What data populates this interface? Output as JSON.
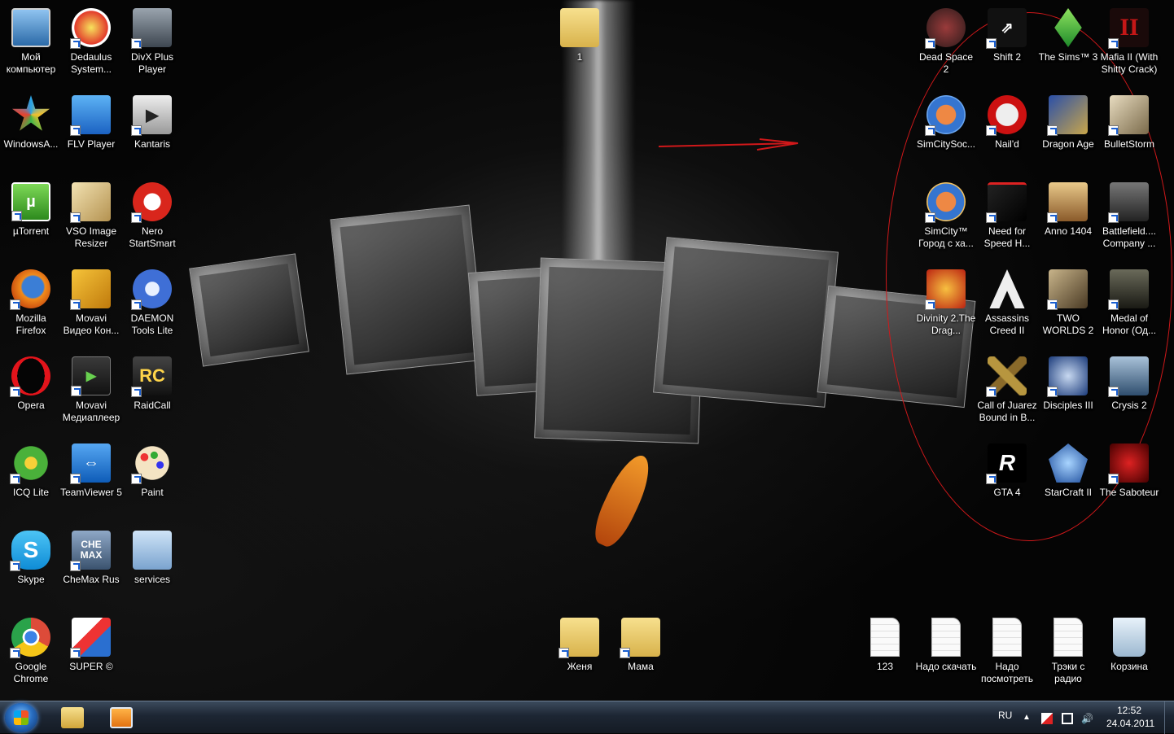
{
  "desktop_icons": {
    "my_computer": "Мой компьютер",
    "dedaulus": "Dedaulus System...",
    "divx": "DivX Plus Player",
    "windowsa": "WindowsA...",
    "flv": "FLV Player",
    "kantaris": "Kantaris",
    "utorrent": "µTorrent",
    "vso": "VSO Image Resizer",
    "nero": "Nero StartSmart",
    "firefox": "Mozilla Firefox",
    "movavi_video": "Movavi Видео Кон...",
    "daemon": "DAEMON Tools Lite",
    "opera": "Opera",
    "movavi_player": "Movavi Медиаплеер",
    "raidcall": "RaidCall",
    "icq": "ICQ Lite",
    "teamviewer": "TeamViewer 5",
    "paint": "Paint",
    "skype": "Skype",
    "chemax": "CheMax Rus",
    "services": "services",
    "chrome": "Google Chrome",
    "super": "SUPER ©",
    "folder_1": "1",
    "zhenya": "Женя",
    "mama": "Мама",
    "dead_space": "Dead Space 2",
    "shift2": "Shift 2",
    "sims3": "The Sims™ 3",
    "mafia2": "Mafia II (With Shitty Crack)",
    "simcity_soc": "SimCitySoc...",
    "naild": "Nail'd",
    "dragon_age": "Dragon Age",
    "bulletstorm": "BulletStorm",
    "simcity_city": "SimCity™ Город с ха...",
    "nfs": "Need for Speed H...",
    "anno": "Anno 1404",
    "battlefield": "Battlefield.... Company ...",
    "divinity": "Divinity 2.The Drag...",
    "assassins": "Assassins Creed II",
    "two_worlds": "TWO WORLDS 2",
    "medal": "Medal of Honor (Од...",
    "coj": "Call of Juarez Bound in B...",
    "disciples": "Disciples III",
    "crysis": "Crysis 2",
    "gta4": "GTA 4",
    "starcraft": "StarCraft II",
    "saboteur": "The Saboteur",
    "f123": "123",
    "nado_skachat": "Надо скачать",
    "nado_posmotret": "Надо посмотреть",
    "treki": "Трэки с радио",
    "recycle": "Корзина"
  },
  "taskbar": {
    "lang": "RU",
    "time": "12:52",
    "date": "24.04.2011",
    "pinned": [
      "explorer-icon",
      "media-player-icon"
    ]
  },
  "annotation_color": "#d0181a"
}
